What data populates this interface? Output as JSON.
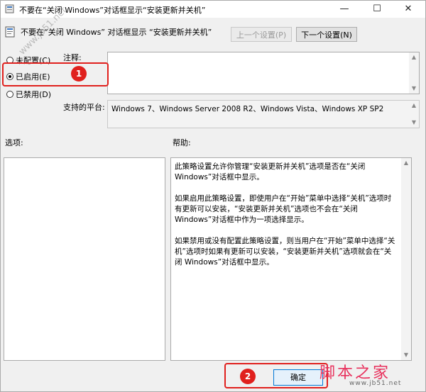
{
  "window": {
    "title": "不要在“关闭 Windows”对话框显示“安装更新并关机”",
    "minimize": "—",
    "maximize": "☐",
    "close": "✕"
  },
  "header": {
    "subtitle": "不要在“关闭 Windows” 对话框显示 “安装更新并关机”",
    "prev_setting": "上一个设置(P)",
    "next_setting": "下一个设置(N)"
  },
  "state": {
    "not_configured": "未配置(C)",
    "enabled": "已启用(E)",
    "disabled": "已禁用(D)",
    "selected": "enabled"
  },
  "comment": {
    "label": "注释:",
    "value": ""
  },
  "platform": {
    "label": "支持的平台:",
    "value": "Windows 7、Windows Server 2008 R2、Windows Vista、Windows XP SP2"
  },
  "options": {
    "label": "选项:"
  },
  "help": {
    "label": "帮助:",
    "paragraphs": [
      "此策略设置允许你管理“安装更新并关机”选项是否在“关闭 Windows”对话框中显示。",
      "如果启用此策略设置，即使用户在“开始”菜单中选择“关机”选项时有更新可以安装，“安装更新并关机”选项也不会在“关闭 Windows”对话框中作为一项选择显示。",
      "如果禁用或没有配置此策略设置，则当用户在“开始”菜单中选择“关机”选项时如果有更新可以安装，“安装更新并关机”选项就会在“关闭 Windows”对话框中显示。"
    ]
  },
  "footer": {
    "ok": "确定"
  },
  "annotations": {
    "badge1": "1",
    "badge2": "2",
    "color": "#e0201d"
  },
  "watermarks": {
    "diagonal": "www.jb51.net",
    "brand": "脚本之家",
    "url": "www.jb51.net"
  }
}
